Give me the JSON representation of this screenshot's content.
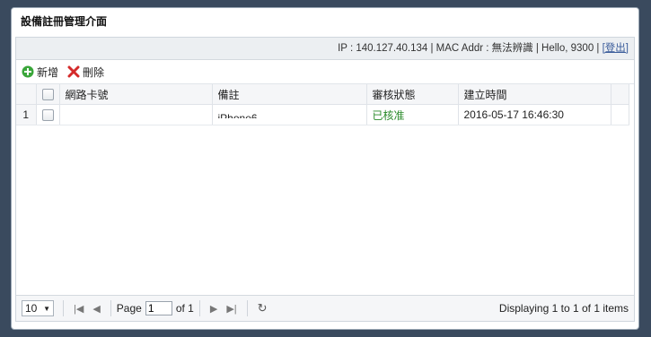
{
  "panel": {
    "title": "設備註冊管理介面"
  },
  "topbar": {
    "text": "IP : 140.127.40.134 | MAC Addr : 無法辨識 |  Hello, 9300 | ",
    "logout": "[登出]"
  },
  "toolbar": {
    "add_label": "新增",
    "delete_label": "刪除"
  },
  "grid": {
    "columns": [
      "網路卡號",
      "備註",
      "審核狀態",
      "建立時間"
    ],
    "rows": [
      {
        "num": "1",
        "mac": "",
        "remark": "iPhone6",
        "status": "已核准",
        "created": "2016-05-17 16:46:30"
      }
    ]
  },
  "pager": {
    "page_size": "10",
    "page_label": "Page",
    "page_value": "1",
    "of_label": "of 1",
    "info": "Displaying 1 to 1 of 1 items"
  },
  "colors": {
    "background": "#3a4a5e",
    "status_green": "#2a8a2a",
    "add_icon": "#3aa63a",
    "delete_icon": "#d42a2a"
  }
}
